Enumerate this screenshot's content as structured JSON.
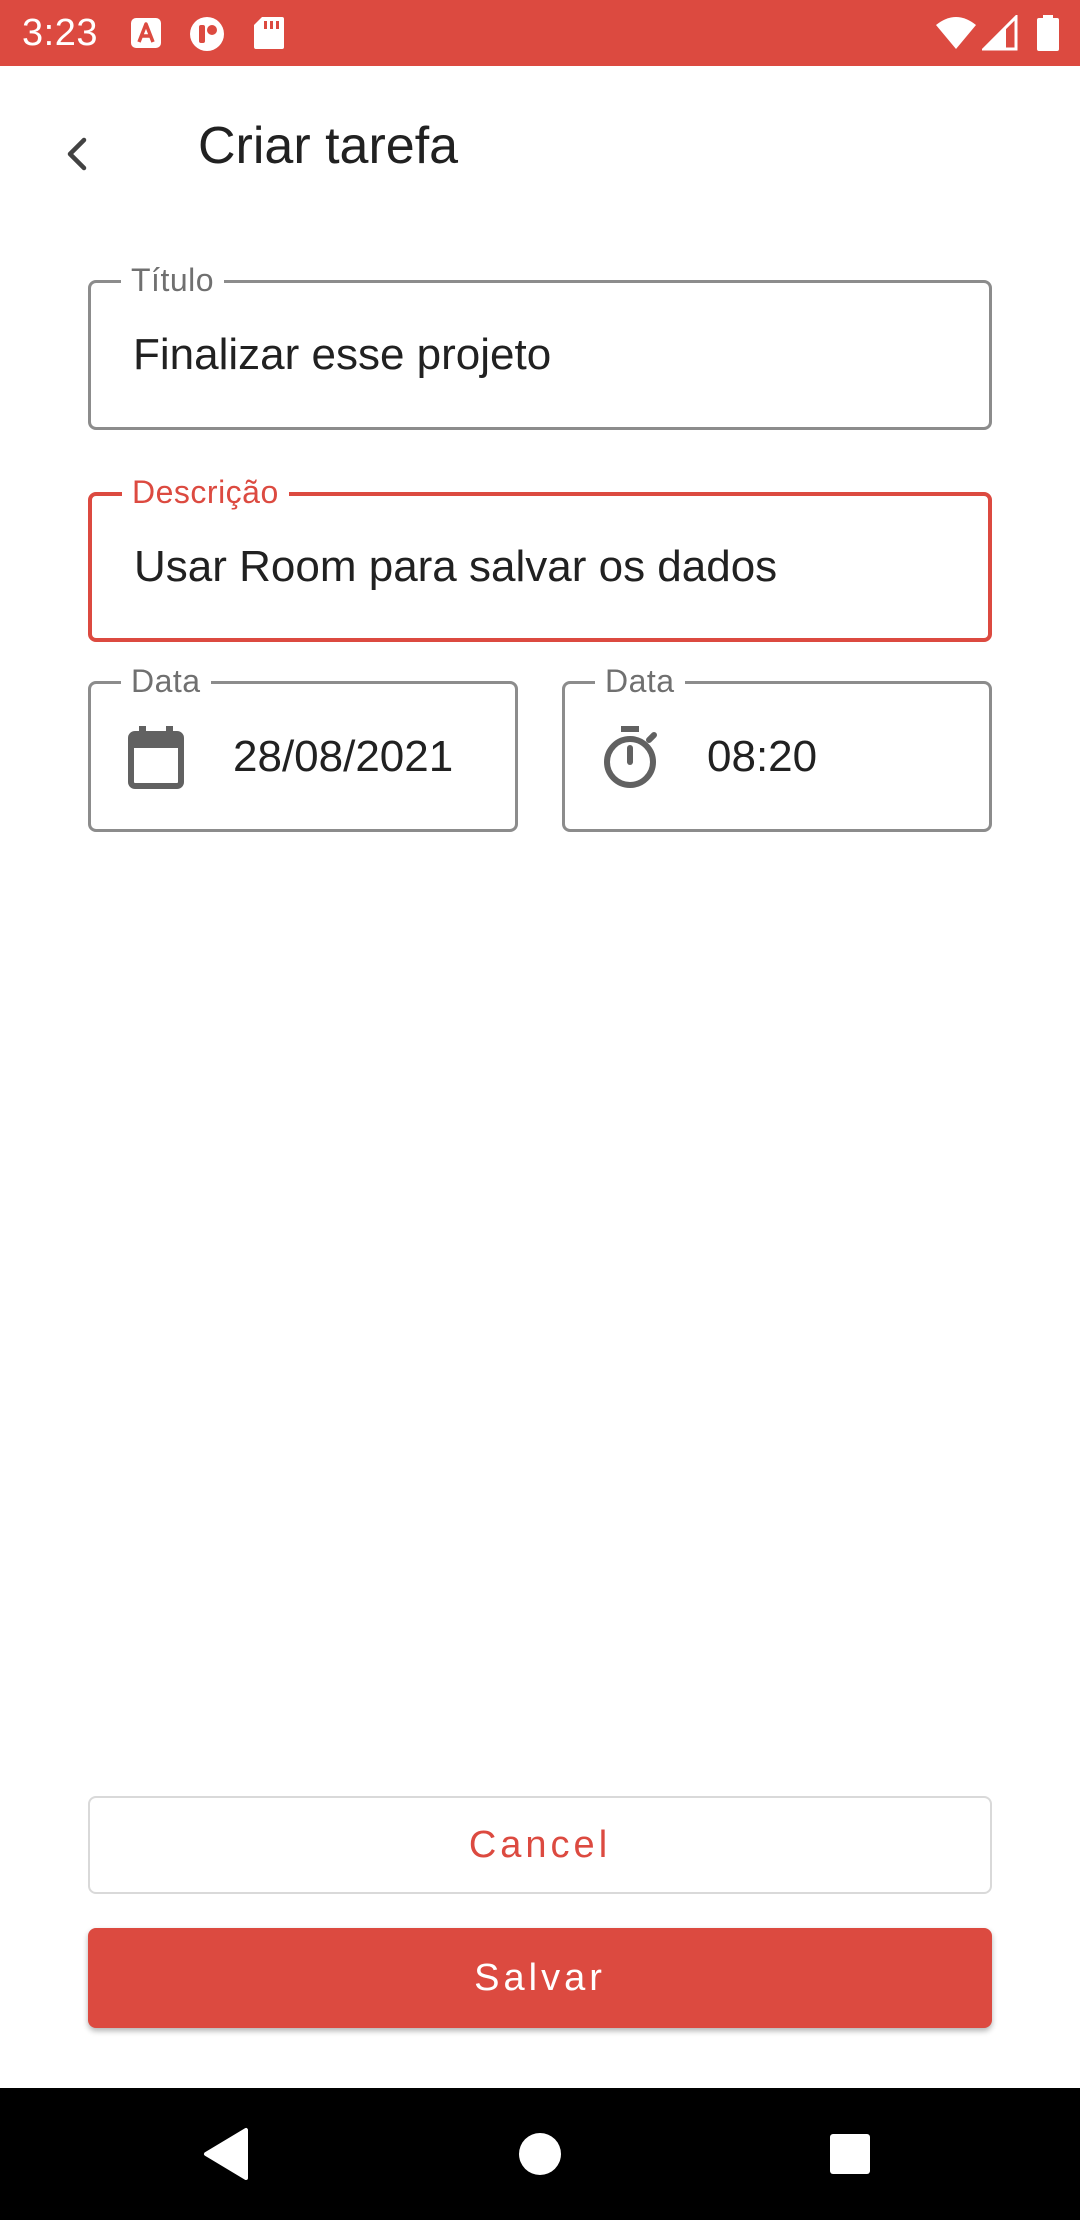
{
  "status_bar": {
    "time": "3:23",
    "background_color": "#dc4a40",
    "left_icons": [
      "a-notification-icon",
      "app-notification-icon",
      "sd-card-icon"
    ],
    "right_icons": [
      "wifi-icon",
      "cell-signal-icon",
      "battery-icon"
    ]
  },
  "app_bar": {
    "title": "Criar tarefa",
    "back_icon": "chevron-left-icon"
  },
  "form": {
    "title_field": {
      "label": "Título",
      "value": "Finalizar esse projeto"
    },
    "description_field": {
      "label": "Descrição",
      "value": "Usar Room para salvar os dados",
      "focused": true
    },
    "date_field": {
      "label": "Data",
      "value": "28/08/2021",
      "icon": "calendar-icon"
    },
    "time_field": {
      "label": "Data",
      "value": "08:20",
      "icon": "timer-icon"
    }
  },
  "actions": {
    "cancel_label": "Cancel",
    "save_label": "Salvar"
  },
  "nav_bar": {
    "buttons": [
      "back-triangle-icon",
      "home-circle-icon",
      "recents-square-icon"
    ]
  },
  "colors": {
    "accent": "#dc4a40",
    "outline": "#8c8c8c",
    "text": "#212121"
  }
}
